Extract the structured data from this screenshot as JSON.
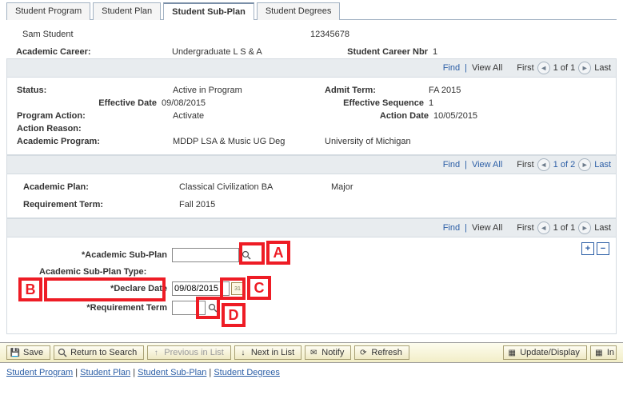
{
  "tabs": {
    "program": "Student Program",
    "plan": "Student Plan",
    "subplan": "Student Sub-Plan",
    "degrees": "Student Degrees"
  },
  "student": {
    "name": "Sam Student",
    "id": "12345678"
  },
  "career": {
    "label": "Academic Career:",
    "value": "Undergraduate L S & A",
    "nbr_label": "Student Career Nbr",
    "nbr_value": "1"
  },
  "navbar": {
    "find": "Find",
    "view_all": "View All",
    "first": "First",
    "last": "Last",
    "of1": "1 of 1",
    "of2": "1 of 2"
  },
  "program": {
    "status_label": "Status:",
    "status_value": "Active in Program",
    "admit_term_label": "Admit Term:",
    "admit_term_value": "FA 2015",
    "eff_date_label": "Effective Date",
    "eff_date_value": "09/08/2015",
    "eff_seq_label": "Effective Sequence",
    "eff_seq_value": "1",
    "action_label": "Program Action:",
    "action_value": "Activate",
    "action_date_label": "Action Date",
    "action_date_value": "10/05/2015",
    "reason_label": "Action Reason:",
    "acad_prog_label": "Academic Program:",
    "acad_prog_value": "MDDP LSA & Music UG Deg",
    "institution": "University of Michigan"
  },
  "plan": {
    "label": "Academic Plan:",
    "value": "Classical Civilization BA",
    "type": "Major",
    "req_term_label": "Requirement Term:",
    "req_term_value": "Fall 2015"
  },
  "subplan": {
    "field_label": "*Academic Sub-Plan",
    "field_value": "",
    "type_label": "Academic Sub-Plan Type:",
    "declare_label": "*Declare Date",
    "declare_value": "09/08/2015",
    "req_term_label": "*Requirement Term",
    "req_term_value": ""
  },
  "callouts": {
    "a": "A",
    "b": "B",
    "c": "C",
    "d": "D"
  },
  "buttons": {
    "save": "Save",
    "return": "Return to Search",
    "prev": "Previous in List",
    "next": "Next in List",
    "notify": "Notify",
    "refresh": "Refresh",
    "update": "Update/Display",
    "include": "In"
  },
  "footer": {
    "program": "Student Program",
    "plan": "Student Plan",
    "subplan": "Student Sub-Plan",
    "degrees": "Student Degrees"
  }
}
